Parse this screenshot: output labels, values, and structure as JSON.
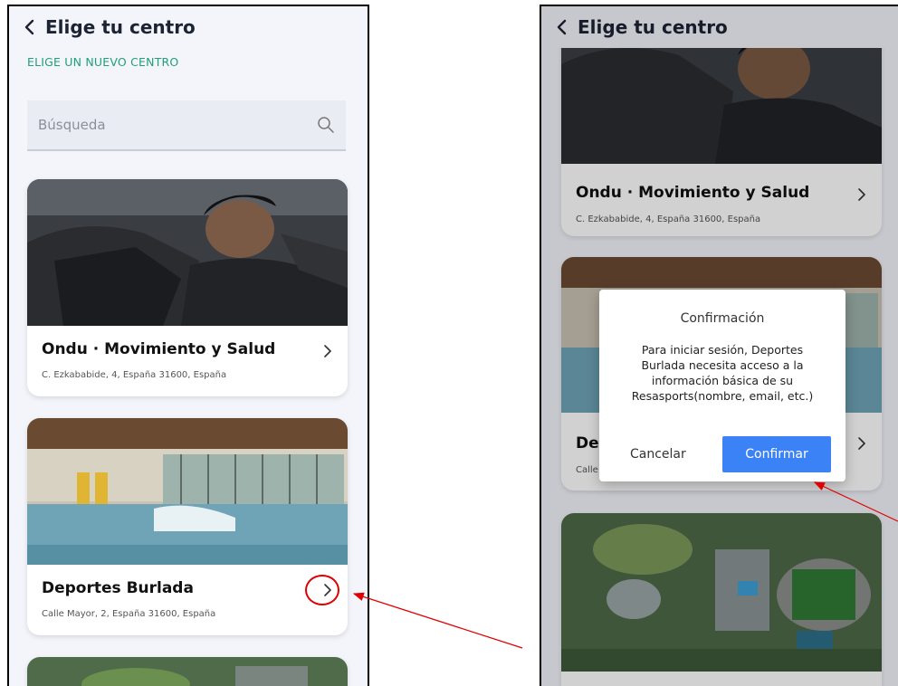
{
  "left_screen": {
    "header": {
      "title": "Elige tu centro"
    },
    "subtitle": "ELIGE UN NUEVO CENTRO",
    "search": {
      "placeholder": "Búsqueda"
    },
    "centers": [
      {
        "name": "Ondu · Movimiento y Salud",
        "address": "C. Ezkababide, 4, España 31600, España",
        "image": "athlete-photo"
      },
      {
        "name": "Deportes Burlada",
        "address": "Calle Mayor, 2, España 31600, España",
        "image": "pool-photo"
      }
    ]
  },
  "right_screen": {
    "header": {
      "title": "Elige tu centro"
    },
    "centers": [
      {
        "name": "Ondu · Movimiento y Salud",
        "address": "C. Ezkababide, 4, España 31600, España"
      },
      {
        "name_visible": "De",
        "address_visible": "Calle"
      }
    ],
    "dialog": {
      "title": "Confirmación",
      "message": "Para iniciar sesión, Deportes Burlada necesita acceso a la información básica de su Resasports(nombre, email, etc.)",
      "cancel_label": "Cancelar",
      "confirm_label": "Confirmar"
    }
  },
  "colors": {
    "accent_green": "#1f9f7a",
    "confirm_blue": "#3b82f6",
    "annotation_red": "#e00000",
    "background": "#f3f5fb"
  }
}
